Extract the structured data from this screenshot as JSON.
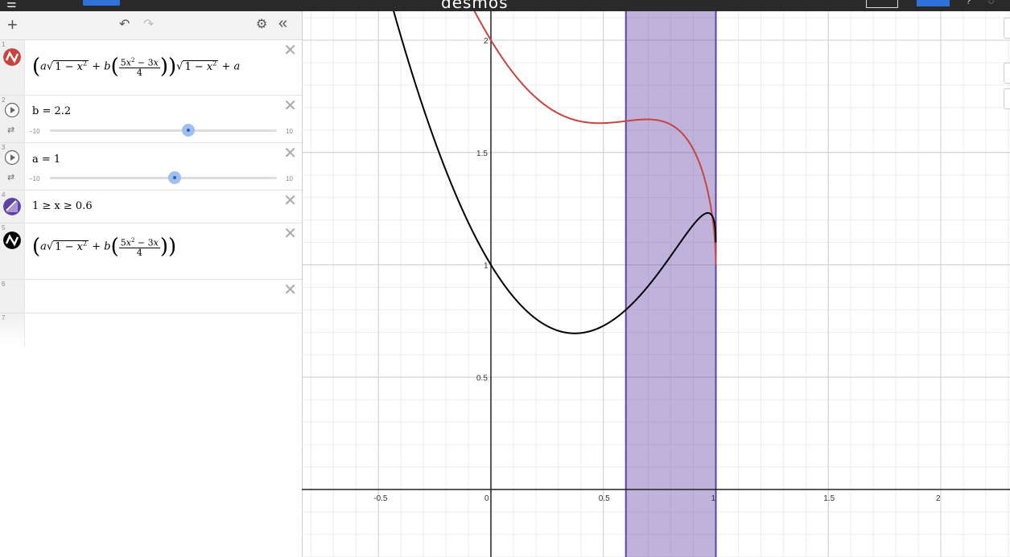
{
  "topbar": {
    "title": "",
    "brand": "desmos",
    "badge": ""
  },
  "toolbar": {
    "add_icon": "plus-icon",
    "undo_icon": "undo-icon",
    "redo_icon": "redo-icon",
    "settings_icon": "gear-icon",
    "collapse_icon": "double-chevron-left-icon"
  },
  "expressions": [
    {
      "id": "1",
      "type": "expression",
      "color": "#c74440",
      "latex_parts": {
        "a": "a",
        "sqrt": "1 − x",
        "exp": "2",
        "b": "b",
        "frac_top": "5x² − 3x",
        "frac_bot": "4"
      }
    },
    {
      "id": "2",
      "type": "slider",
      "label": "b = 2.2",
      "min": "−10",
      "max": "10",
      "value": 2.2
    },
    {
      "id": "3",
      "type": "slider",
      "label": "a = 1",
      "min": "−10",
      "max": "10",
      "value": 1
    },
    {
      "id": "4",
      "type": "inequality",
      "label": "1 ≥ x ≥ 0.6",
      "color": "#6042a6"
    },
    {
      "id": "5",
      "type": "expression",
      "color": "#000000"
    },
    {
      "id": "6",
      "type": "empty"
    },
    {
      "id": "7",
      "type": "empty"
    }
  ],
  "graph": {
    "x_ticks": [
      "-0.5",
      "0",
      "0.5",
      "1",
      "1.5",
      "2"
    ],
    "y_ticks": [
      "2",
      "1.5",
      "1",
      "0.5"
    ],
    "shaded_region": {
      "x_min": 0.6,
      "x_max": 1,
      "color": "#6042a6"
    },
    "curves": [
      {
        "color": "#c74440",
        "label": "expression 1"
      },
      {
        "color": "#000000",
        "label": "expression 5"
      }
    ]
  }
}
